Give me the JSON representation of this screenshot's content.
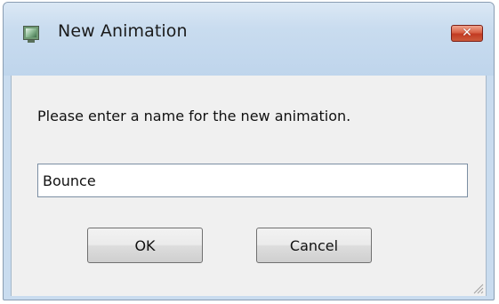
{
  "window": {
    "title": "New Animation",
    "close_label": "✕"
  },
  "dialog": {
    "prompt": "Please enter a name for the new animation.",
    "name_value": "Bounce"
  },
  "buttons": {
    "ok_label": "OK",
    "cancel_label": "Cancel"
  },
  "icons": {
    "app": "app-icon",
    "close": "close-icon",
    "resize": "resize-grip-icon"
  },
  "colors": {
    "title_bar": "#c9dcef",
    "client_bg": "#f0f0f0",
    "close_button": "#c23a22"
  }
}
